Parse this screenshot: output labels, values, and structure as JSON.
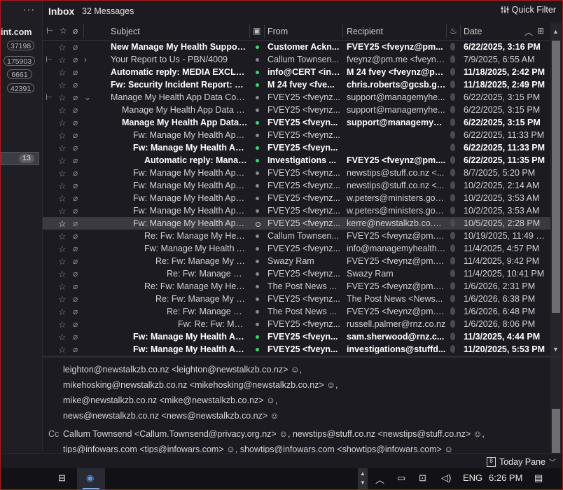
{
  "folders": {
    "menu_dots": "···",
    "account_label": "int.com",
    "counts": [
      "37198",
      "175903",
      "6661",
      "42391"
    ],
    "selected_count": "13"
  },
  "header": {
    "title": "Inbox",
    "message_count": "32 Messages",
    "quick_filter": "Quick Filter"
  },
  "columns": {
    "subject": "Subject",
    "from": "From",
    "recipient": "Recipient",
    "date": "Date"
  },
  "messages": [
    {
      "subject": "New Manage My Health Support ...",
      "from": "Customer Ackn...",
      "recipient": "FVEY25 <fveynz@pm...",
      "date": "6/22/2025, 3:16 PM",
      "bold": true,
      "unread": true,
      "indent": 0
    },
    {
      "subject": "Your Report to Us - PBN/4009",
      "from": "Callum Townsen...",
      "recipient": "fveynz@pm.me <fveynz...",
      "date": "7/9/2025, 6:55 AM",
      "bold": false,
      "unread": false,
      "indent": 0,
      "thread": "collapsed"
    },
    {
      "subject": "Automatic reply: MEDIA EXCLUSI...",
      "from": "info@CERT <inf...",
      "recipient": "M 24 fvey <fveynz@pm...",
      "date": "11/18/2025, 2:42 PM",
      "bold": true,
      "unread": true,
      "indent": 0
    },
    {
      "subject": "Fw: Security Incident Report: Exp...",
      "from": "M 24 fvey <fve...",
      "recipient": "chris.roberts@gcsb.gov...",
      "date": "11/18/2025, 2:49 PM",
      "bold": true,
      "unread": true,
      "indent": 0
    },
    {
      "subject": "Manage My Health App Data Conce...",
      "from": "FVEY25 <fveynz...",
      "recipient": "support@managemyhe...",
      "date": "6/22/2025, 3:15 PM",
      "bold": false,
      "unread": false,
      "indent": 0,
      "thread": "expanded"
    },
    {
      "subject": "Manage My Health App Data Co...",
      "from": "FVEY25 <fveynz...",
      "recipient": "support@managemyhe...",
      "date": "6/22/2025, 3:15 PM",
      "bold": false,
      "unread": false,
      "indent": 1
    },
    {
      "subject": "Manage My Health App Data ...",
      "from": "FVEY25 <fveyn...",
      "recipient": "support@managemyh...",
      "date": "6/22/2025, 3:15 PM",
      "bold": true,
      "unread": true,
      "indent": 1
    },
    {
      "subject": "Fw: Manage My Health App D...",
      "from": "FVEY25 <fveynz...",
      "recipient": "",
      "date": "6/22/2025, 11:33 PM",
      "bold": false,
      "unread": false,
      "indent": 2
    },
    {
      "subject": "Fw: Manage My Health App...",
      "from": "FVEY25 <fveyn...",
      "recipient": "",
      "date": "6/22/2025, 11:33 PM",
      "bold": true,
      "unread": true,
      "indent": 2
    },
    {
      "subject": "Automatic reply: Manag...",
      "from": "Investigations ...",
      "recipient": "FVEY25 <fveynz@pm....",
      "date": "6/22/2025, 11:35 PM",
      "bold": true,
      "unread": true,
      "indent": 3
    },
    {
      "subject": "Fw: Manage My Health App D...",
      "from": "FVEY25 <fveynz...",
      "recipient": "newstips@stuff.co.nz <...",
      "date": "8/7/2025, 5:20 PM",
      "bold": false,
      "unread": false,
      "indent": 2
    },
    {
      "subject": "Fw: Manage My Health App D...",
      "from": "FVEY25 <fveynz...",
      "recipient": "newstips@stuff.co.nz <...",
      "date": "10/2/2025, 2:14 AM",
      "bold": false,
      "unread": false,
      "indent": 2
    },
    {
      "subject": "Fw: Manage My Health App D...",
      "from": "FVEY25 <fveynz...",
      "recipient": "w.peters@ministers.gov...",
      "date": "10/2/2025, 3:53 AM",
      "bold": false,
      "unread": false,
      "indent": 2
    },
    {
      "subject": "Fw: Manage My Health App D...",
      "from": "FVEY25 <fveynz...",
      "recipient": "w.peters@ministers.gov...",
      "date": "10/2/2025, 3:53 AM",
      "bold": false,
      "unread": false,
      "indent": 2
    },
    {
      "subject": "Fw: Manage My Health App D...",
      "from": "FVEY25 <fveynz...",
      "recipient": "kerre@newstalkzb.co.nz...",
      "date": "10/5/2025, 2:28 PM",
      "bold": false,
      "unread": false,
      "indent": 2,
      "selected": true
    },
    {
      "subject": "Re: Fw: Manage My Health App...",
      "from": "Callum Townsen...",
      "recipient": "FVEY25 <fveynz@pm.m...",
      "date": "10/19/2025, 11:49 PM",
      "bold": false,
      "unread": false,
      "indent": 3
    },
    {
      "subject": "Fw: Manage My Health Ap...",
      "from": "FVEY25 <fveynz...",
      "recipient": "info@managemyhealth....",
      "date": "11/4/2025, 4:57 PM",
      "bold": false,
      "unread": false,
      "indent": 3
    },
    {
      "subject": "Re: Fw: Manage My Hea...",
      "from": "Swazy Ram",
      "recipient": "FVEY25 <fveynz@pm.m...",
      "date": "11/4/2025, 9:42 PM",
      "bold": false,
      "unread": false,
      "indent": 4
    },
    {
      "subject": "Re: Fw: Manage My ...",
      "from": "FVEY25 <fveynz...",
      "recipient": "Swazy Ram",
      "date": "11/4/2025, 10:41 PM",
      "bold": false,
      "unread": false,
      "indent": 5
    },
    {
      "subject": "Re: Fw: Manage My Health...",
      "from": "The Post News ...",
      "recipient": "FVEY25 <fveynz@pm.m...",
      "date": "1/6/2026, 2:31 PM",
      "bold": false,
      "unread": false,
      "indent": 3
    },
    {
      "subject": "Re: Fw: Manage My Hea...",
      "from": "FVEY25 <fveynz...",
      "recipient": "The Post News <News...",
      "date": "1/6/2026, 6:38 PM",
      "bold": false,
      "unread": false,
      "indent": 4
    },
    {
      "subject": "Re: Fw: Manage My ...",
      "from": "The Post News ...",
      "recipient": "FVEY25 <fveynz@pm.m...",
      "date": "1/6/2026, 6:48 PM",
      "bold": false,
      "unread": false,
      "indent": 5
    },
    {
      "subject": "Fw: Re: Fw: Mana...",
      "from": "FVEY25 <fveynz...",
      "recipient": "russell.palmer@rnz.co.nz",
      "date": "1/6/2026, 8:06 PM",
      "bold": false,
      "unread": false,
      "indent": 6
    },
    {
      "subject": "Fw: Manage My Health App...",
      "from": "FVEY25 <fveyn...",
      "recipient": "sam.sherwood@rnz.c...",
      "date": "11/3/2025, 4:44 PM",
      "bold": true,
      "unread": true,
      "indent": 2
    },
    {
      "subject": "Fw: Manage My Health App...",
      "from": "FVEY25 <fveyn...",
      "recipient": "investigations@stuffd...",
      "date": "11/20/2025, 5:53 PM",
      "bold": true,
      "unread": true,
      "indent": 2
    }
  ],
  "preview": {
    "to_lines": [
      "leighton@newstalkzb.co.nz <leighton@newstalkzb.co.nz>",
      "mikehosking@newstalkzb.co.nz <mikehosking@newstalkzb.co.nz>",
      "mike@newstalkzb.co.nz <mike@newstalkzb.co.nz>",
      "news@newstalkzb.co.nz <news@newstalkzb.co.nz>"
    ],
    "cc_label": "Cc",
    "cc_lines": [
      "Callum Townsend <Callum.Townsend@privacy.org.nz>",
      "newstips@stuff.co.nz <newstips@stuff.co.nz>",
      "tips@infowars.com <tips@infowars.com>",
      "showtips@infowars.com <showtips@infowars.com>"
    ],
    "separator": ","
  },
  "statusbar": {
    "today_pane": "Today Pane",
    "calendar_day": "8"
  },
  "taskbar": {
    "language": "ENG",
    "time": "6:26 PM"
  },
  "colors": {
    "background": "#1c1b22",
    "unread_dot": "#3bd671",
    "selection": "#3a3a40",
    "window_border": "#b01818"
  }
}
